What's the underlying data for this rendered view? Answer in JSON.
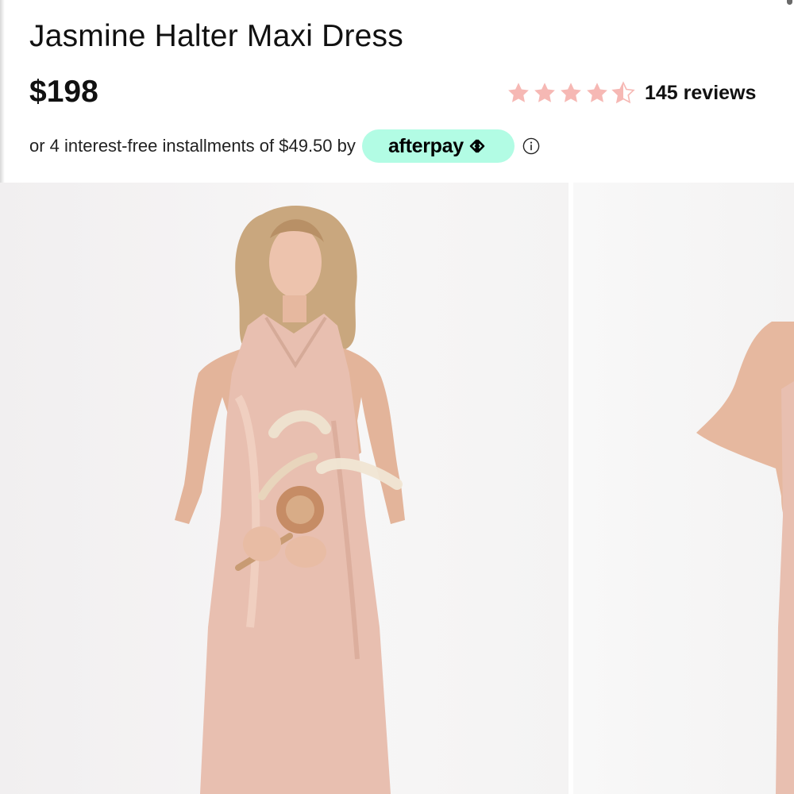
{
  "product": {
    "title": "Jasmine Halter Maxi Dress",
    "price": "$198"
  },
  "rating": {
    "value": 4.5,
    "max": 5,
    "reviews_label": "145 reviews",
    "star_color": "#f6b8b4"
  },
  "payment": {
    "installments_text": "or 4 interest-free installments of $49.50 by",
    "provider_label": "afterpay",
    "provider_color": "#b2fce4",
    "provider_logo_icon": "afterpay-arrows-icon",
    "info_icon": "info-circle-icon"
  },
  "gallery": {
    "images": [
      {
        "name": "front-view",
        "dress_color": "#e8bfb0"
      },
      {
        "name": "side-view",
        "dress_color": "#e8bfb0"
      }
    ]
  }
}
